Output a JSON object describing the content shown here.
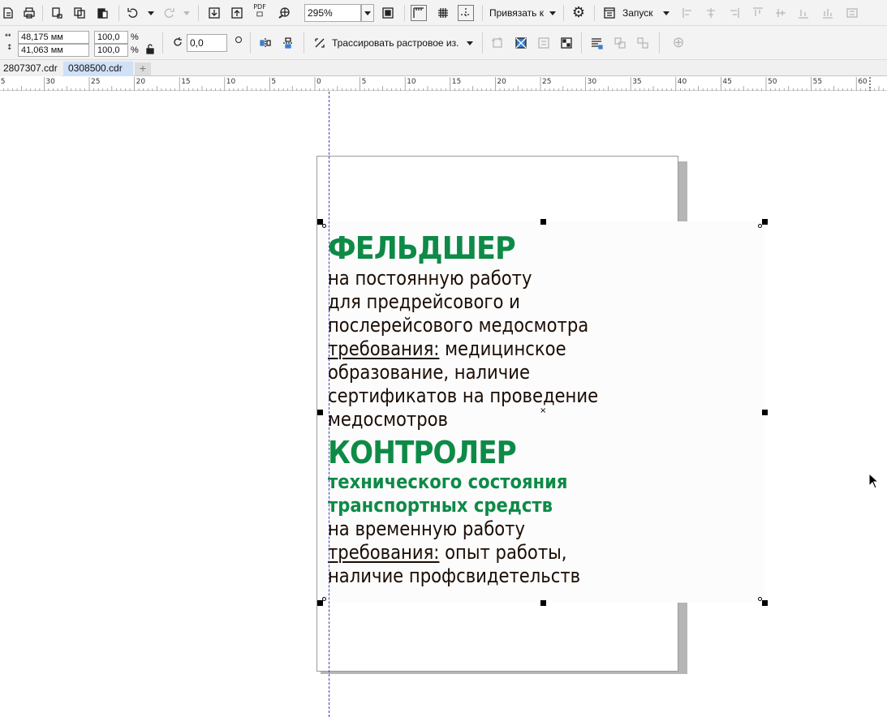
{
  "toolbar_top": {
    "zoom_value": "295%",
    "snap_label": "Привязать к",
    "launch_label": "Запуск",
    "pdf_label": "PDF"
  },
  "toolbar_props": {
    "width_value": "48,175 мм",
    "height_value": "41,063 мм",
    "scale_x": "100,0",
    "scale_y": "100,0",
    "percent": "%",
    "rotation_value": "0,0",
    "trace_label": "Трассировать растровое из."
  },
  "tabs": [
    {
      "label": "2807307.cdr",
      "active": false
    },
    {
      "label": "0308500.cdr",
      "active": true
    }
  ],
  "ruler": {
    "labels": [
      "5",
      "30",
      "25",
      "20",
      "15",
      "10",
      "5",
      "0",
      "5",
      "10",
      "15",
      "20",
      "25",
      "30",
      "35",
      "40",
      "45",
      "50",
      "55",
      "60"
    ]
  },
  "document": {
    "heading1": "ФЕЛЬДШЕР",
    "line1": "на постоянную работу",
    "line2": "для предрейсового и",
    "line3": "послерейсового медосмотра",
    "req_label_1": "требования:",
    "req_text_1": " медицинское",
    "line5": "образование, наличие",
    "line6": "сертификатов на проведение",
    "line7": "медосмотров",
    "heading2": "КОНТРОЛЕР",
    "sub1": "технического состояния",
    "sub2": "транспортных средств",
    "line8": "на временную работу",
    "req_label_2": "требования:",
    "req_text_2": " опыт работы,",
    "line10": "наличие профсвидетельств"
  },
  "colors": {
    "heading_green": "#0e8a47",
    "body_text": "#1b0d04",
    "guide": "#3d3dbb",
    "active_tab": "#cfe1f7"
  }
}
